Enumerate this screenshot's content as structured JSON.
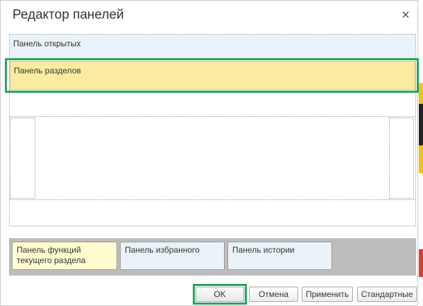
{
  "dialog": {
    "title": "Редактор панелей"
  },
  "layout": {
    "open_panel": "Панель открытых",
    "sections_panel": "Панель разделов"
  },
  "available_panels": [
    {
      "label": "Панель функций текущего раздела"
    },
    {
      "label": "Панель избранного"
    },
    {
      "label": "Панель истории"
    }
  ],
  "buttons": {
    "ok": "OK",
    "cancel": "Отмена",
    "apply": "Применить",
    "standard": "Стандартные"
  },
  "colors": {
    "highlight": "#22a85a",
    "sections_panel_bg": "#fbeb9e",
    "open_panel_bg": "#e8f2f8"
  }
}
